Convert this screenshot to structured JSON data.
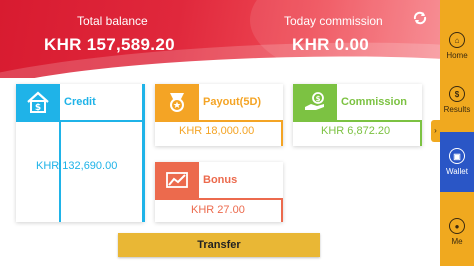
{
  "header": {
    "total_balance_label": "Total balance",
    "total_balance_value": "KHR 157,589.20",
    "today_commission_label": "Today commission",
    "today_commission_value": "KHR 0.00",
    "refresh_icon": "refresh-icon"
  },
  "cards": {
    "credit": {
      "title": "Credit",
      "value": "KHR 132,690.00",
      "icon": "home-dollar-icon",
      "color": "#1fb3e8"
    },
    "payout": {
      "title": "Payout(5D)",
      "value": "KHR 18,000.00",
      "icon": "medal-icon",
      "color": "#f4a425"
    },
    "commission": {
      "title": "Commission",
      "value": "KHR 6,872.20",
      "icon": "hand-money-icon",
      "color": "#7cc242"
    },
    "bonus": {
      "title": "Bonus",
      "value": "KHR 27.00",
      "icon": "chart-icon",
      "color": "#ec6a4d"
    }
  },
  "transfer_label": "Transfer",
  "sidebar": {
    "items": [
      {
        "label": "Home",
        "icon": "home-icon"
      },
      {
        "label": "Results",
        "icon": "dollar-icon"
      },
      {
        "label": "Wallet",
        "icon": "wallet-icon",
        "active": true
      },
      {
        "label": "Me",
        "icon": "user-icon"
      }
    ],
    "collapse_glyph": "›"
  },
  "colors": {
    "accent": "#d81b30",
    "sidebar": "#f0a91f",
    "active": "#2a56c6",
    "button": "#e9b735"
  }
}
